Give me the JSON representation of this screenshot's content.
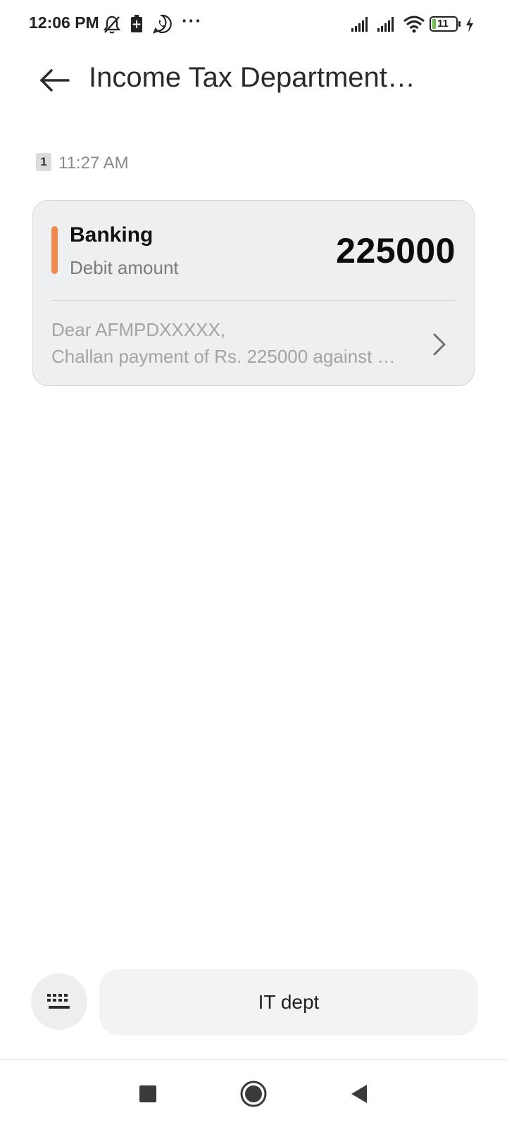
{
  "status_bar": {
    "time": "12:06 PM",
    "ellipsis": "···",
    "battery_level": "11",
    "icons": [
      "mute-bell-icon",
      "battery-saver-icon",
      "whatsapp-icon",
      "signal-icon",
      "signal-icon",
      "wifi-icon",
      "battery-icon",
      "charging-icon"
    ]
  },
  "header": {
    "title": "Income Tax Department…",
    "back_icon": "back-arrow-icon"
  },
  "message": {
    "sim_badge": "1",
    "time": "11:27 AM"
  },
  "card": {
    "category": "Banking",
    "subtitle": "Debit amount",
    "amount": "225000",
    "preview_line1": "Dear AFMPDXXXXX,",
    "preview_line2": "Challan payment of Rs. 225000 against …",
    "accent_color": "#f0894e",
    "chevron_icon": "chevron-right-icon"
  },
  "reply": {
    "keyboard_icon": "keyboard-icon",
    "quick_reply": "IT dept"
  },
  "nav": {
    "icons": [
      "recents-square-icon",
      "home-circle-icon",
      "back-triangle-icon"
    ]
  }
}
